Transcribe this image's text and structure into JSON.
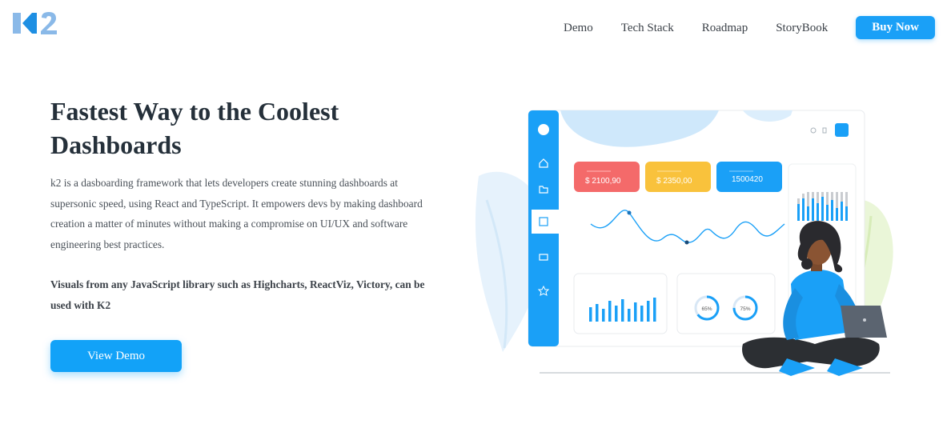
{
  "brand": {
    "logo_text": "K2"
  },
  "nav": {
    "items": [
      "Demo",
      "Tech Stack",
      "Roadmap",
      "StoryBook"
    ],
    "cta": "Buy Now"
  },
  "hero": {
    "title": "Fastest Way to the Coolest Dashboards",
    "description": "k2 is a dasboarding framework that lets developers create stunning dashboards at supersonic speed, using React and TypeScript. It empowers devs by making dashboard creation a matter of minutes without making a compromise on UI/UX and software engineering best practices.",
    "visuals_note": "Visuals from any JavaScript library such as Highcharts, ReactViz, Victory, can be used with K2",
    "button": "View Demo"
  },
  "illustration": {
    "cards": [
      "$ 2100,90",
      "$ 2350,00",
      "1500420"
    ],
    "donuts": [
      "65%",
      "75%"
    ],
    "colors": {
      "accent": "#1aa0f7",
      "red": "#f46a6a",
      "yellow": "#f9c23c",
      "blue": "#1aa0f7"
    }
  }
}
